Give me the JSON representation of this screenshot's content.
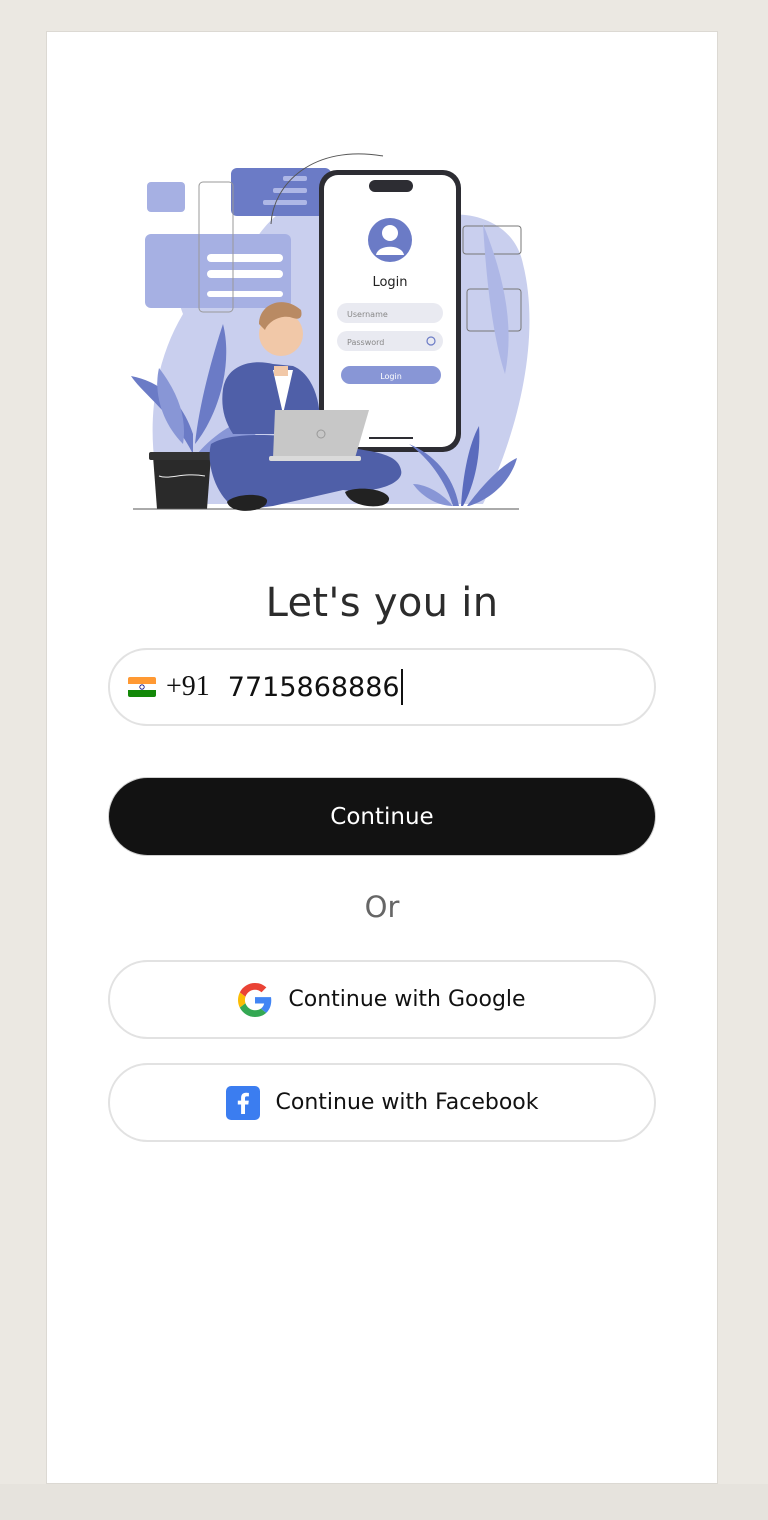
{
  "login_card": {
    "title": "Let's you in",
    "illustration": {
      "name": "login-illustration",
      "phone_screen": {
        "heading": "Login",
        "username_placeholder": "Username",
        "password_placeholder": "Password",
        "button_label": "Login"
      }
    },
    "phone_input": {
      "country_flag_icon": "india-flag-icon",
      "country_code": "+91",
      "value": "7715868886"
    },
    "continue_button": {
      "label": "Continue"
    },
    "divider_text": "Or",
    "google_button": {
      "label": "Continue with Google",
      "icon": "google-icon"
    },
    "facebook_button": {
      "label": "Continue with Facebook",
      "icon": "facebook-icon"
    }
  },
  "colors": {
    "primary_button": "#121212",
    "accent_illustration": "#6b7bc6",
    "background": "#ebe8e2",
    "facebook_blue": "#3b7df0"
  }
}
